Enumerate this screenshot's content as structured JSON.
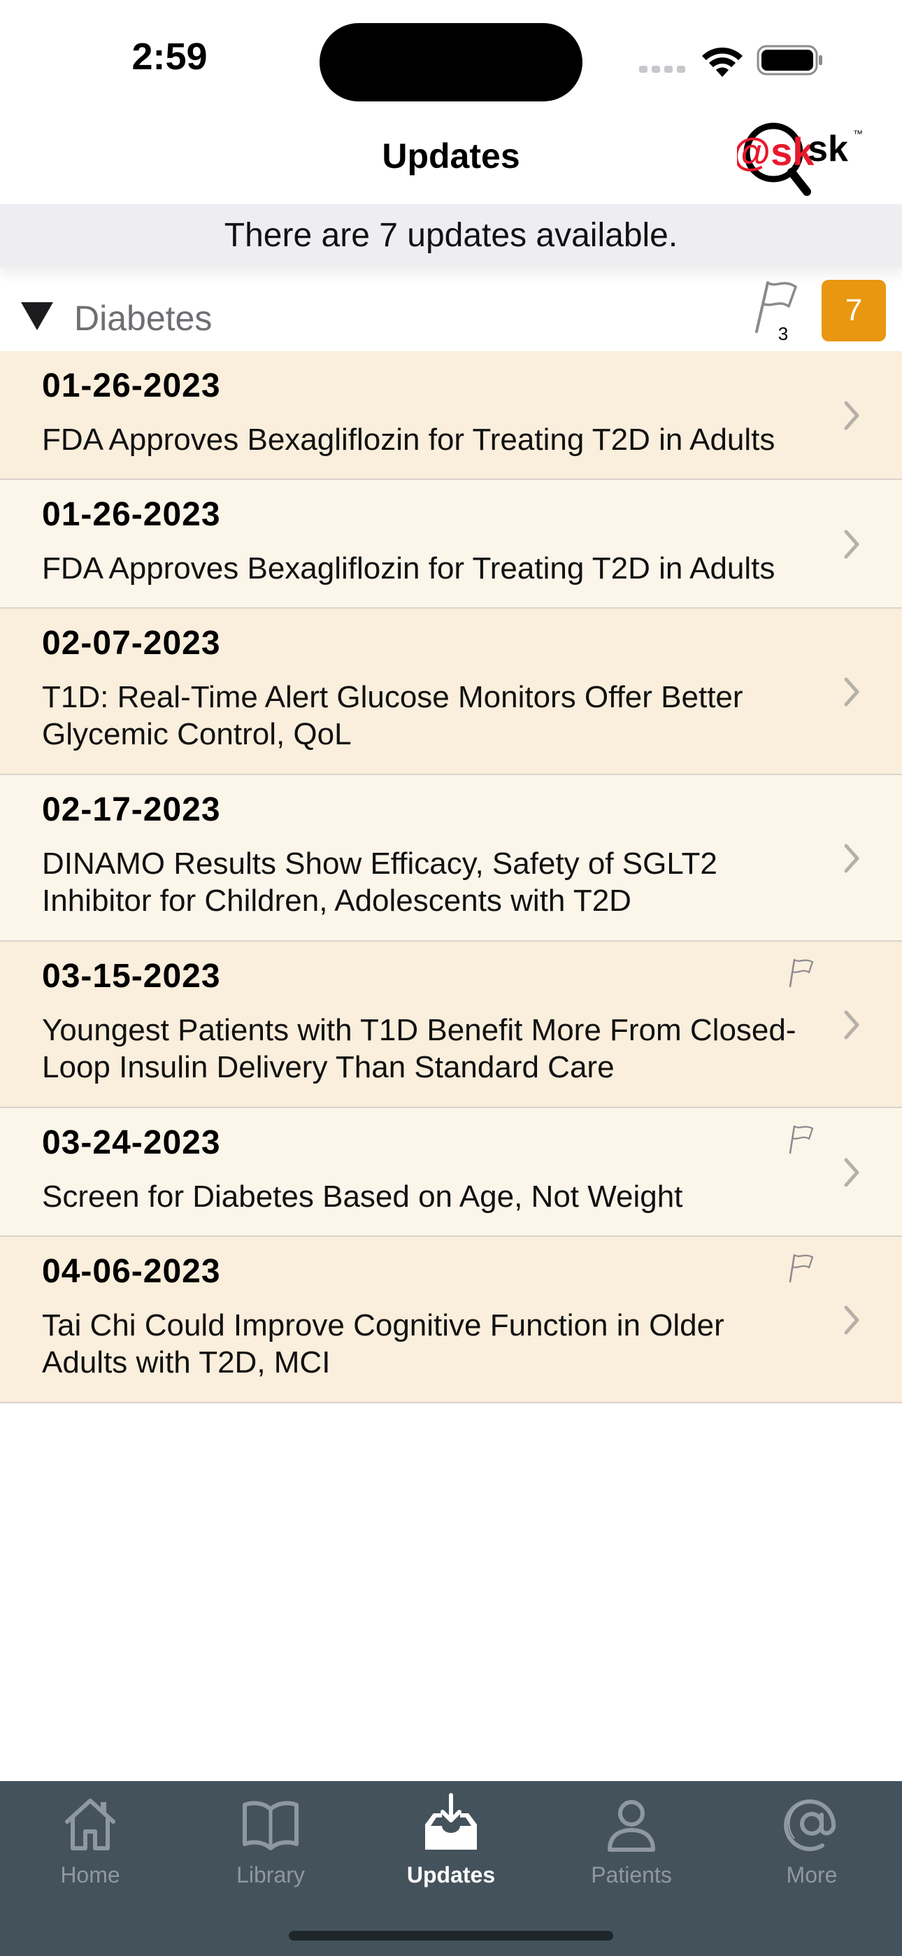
{
  "status_bar": {
    "time": "2:59"
  },
  "header": {
    "title": "Updates",
    "logo_text": "@sk",
    "logo_trademark": "™"
  },
  "banner": {
    "text": "There are 7 updates available."
  },
  "section": {
    "title": "Diabetes",
    "flagged_count": "3",
    "update_count": "7",
    "badge_color": "#e99710"
  },
  "updates": [
    {
      "date": "01-26-2023",
      "title": "FDA Approves Bexagliflozin for Treating T2D in Adults",
      "flagged": false
    },
    {
      "date": "01-26-2023",
      "title": "FDA Approves Bexagliflozin for Treating T2D in Adults",
      "flagged": false
    },
    {
      "date": "02-07-2023",
      "title": "T1D: Real-Time Alert Glucose Monitors Offer Better Glycemic Control, QoL",
      "flagged": false
    },
    {
      "date": "02-17-2023",
      "title": "DINAMO Results Show Efficacy, Safety of SGLT2 Inhibitor for Children, Adolescents with T2D",
      "flagged": false
    },
    {
      "date": "03-15-2023",
      "title": "Youngest Patients with T1D Benefit More From Closed-Loop Insulin Delivery Than Standard Care",
      "flagged": true
    },
    {
      "date": "03-24-2023",
      "title": "Screen for Diabetes Based on Age, Not Weight",
      "flagged": true
    },
    {
      "date": "04-06-2023",
      "title": "Tai Chi Could Improve Cognitive Function in Older Adults with T2D, MCI",
      "flagged": true
    }
  ],
  "tab_bar": {
    "tabs": [
      {
        "label": "Home",
        "icon": "home-icon"
      },
      {
        "label": "Library",
        "icon": "book-icon"
      },
      {
        "label": "Updates",
        "icon": "inbox-download-icon",
        "active": true
      },
      {
        "label": "Patients",
        "icon": "person-icon"
      },
      {
        "label": "More",
        "icon": "at-sign-icon"
      }
    ]
  },
  "colors": {
    "row_dark": "#faeedc",
    "row_light": "#fcf5ea",
    "tab_bar": "#44525c",
    "logo_red": "#e8192c"
  }
}
